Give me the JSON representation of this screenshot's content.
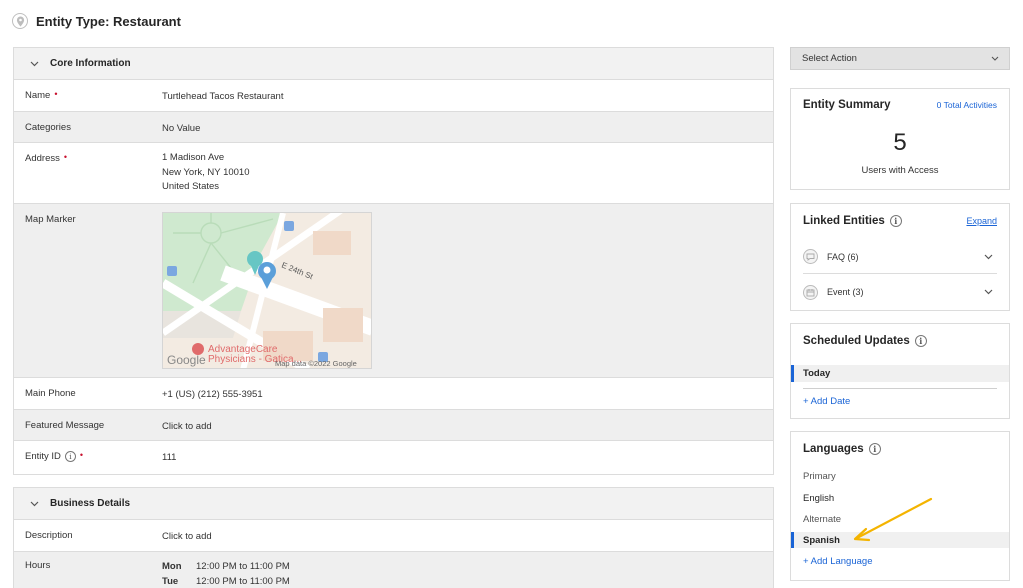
{
  "header": {
    "title": "Entity Type: Restaurant",
    "icon": "map-pin-icon"
  },
  "core": {
    "title": "Core Information",
    "fields": {
      "name": {
        "label": "Name",
        "value": "Turtlehead Tacos Restaurant"
      },
      "categories": {
        "label": "Categories",
        "value": "No Value"
      },
      "address": {
        "label": "Address",
        "line1": "1 Madison Ave",
        "line2": "New York, NY 10010",
        "line3": "United States"
      },
      "map_marker": {
        "label": "Map Marker",
        "map": {
          "street": "E 24th St",
          "poi_line1": "AdvantageCare",
          "poi_line2": "Physicians - Gatica...",
          "credit": "Map data ©2022 Google",
          "logo": "Google"
        }
      },
      "main_phone": {
        "label": "Main Phone",
        "value": "+1 (US) (212) 555-3951"
      },
      "featured_message": {
        "label": "Featured Message",
        "value": "Click to add"
      },
      "entity_id": {
        "label": "Entity ID",
        "value": "111"
      }
    }
  },
  "business": {
    "title": "Business Details",
    "description": {
      "label": "Description",
      "value": "Click to add"
    },
    "hours": {
      "label": "Hours",
      "rows": [
        {
          "day": "Mon",
          "time": "12:00 PM to 11:00 PM"
        },
        {
          "day": "Tue",
          "time": "12:00 PM to 11:00 PM"
        }
      ]
    }
  },
  "sidebar": {
    "select_action": "Select Action",
    "summary": {
      "title": "Entity Summary",
      "activities_link": "0 Total Activities",
      "count": "5",
      "count_label": "Users with Access"
    },
    "linked": {
      "title": "Linked Entities",
      "expand": "Expand",
      "items": [
        {
          "label": "FAQ (6)",
          "icon": "faq-icon"
        },
        {
          "label": "Event (3)",
          "icon": "calendar-icon"
        }
      ]
    },
    "scheduled": {
      "title": "Scheduled Updates",
      "today": "Today",
      "add": "+ Add Date"
    },
    "languages": {
      "title": "Languages",
      "primary_label": "Primary",
      "primary": "English",
      "alternate_label": "Alternate",
      "alternate": "Spanish",
      "add": "+ Add Language"
    }
  },
  "colors": {
    "accent": "#1a64d6",
    "required": "#c8102e",
    "arrow": "#f4b400"
  }
}
